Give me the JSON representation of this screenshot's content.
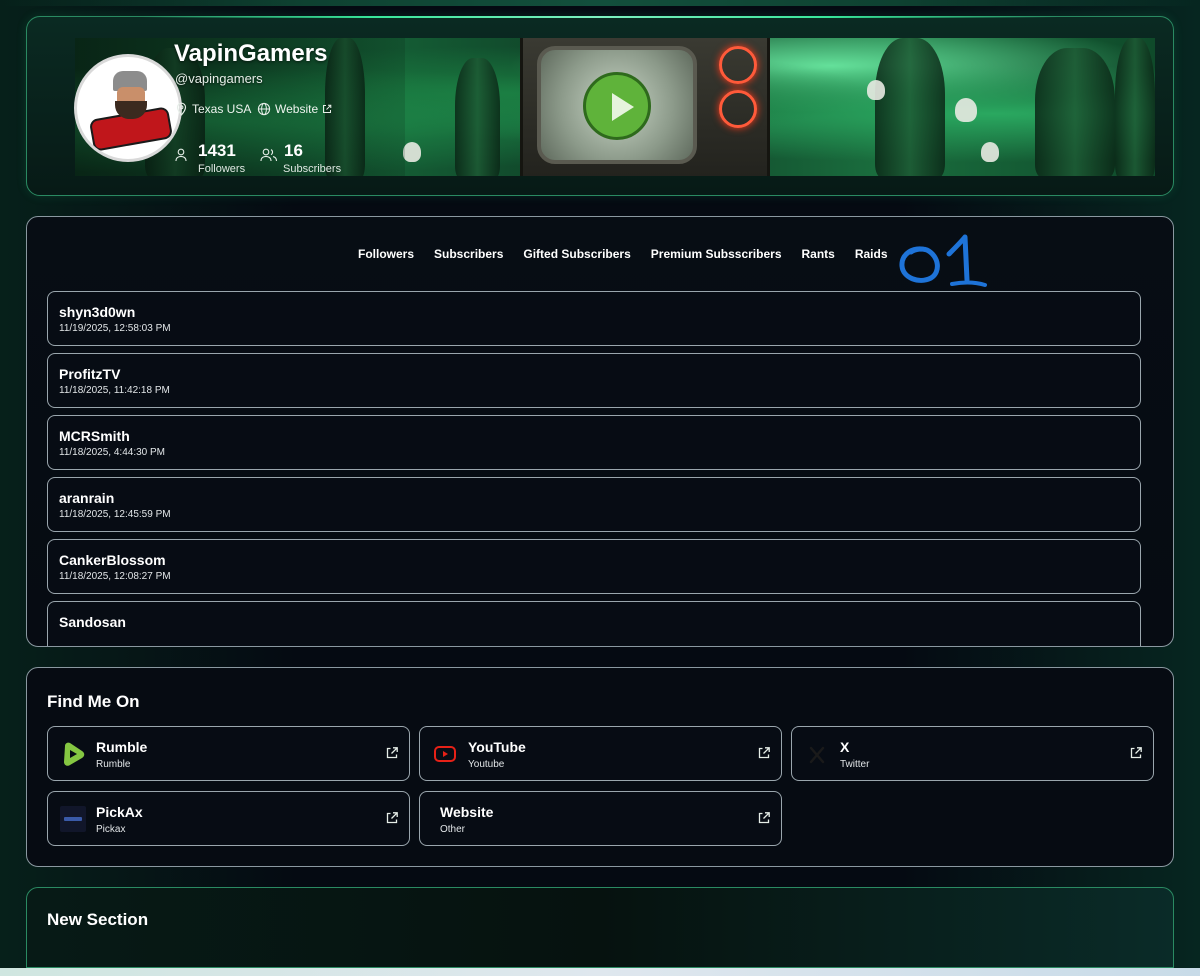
{
  "profile": {
    "name": "VapinGamers",
    "handle": "@vapingamers",
    "location": "Texas USA",
    "website_label": "Website",
    "followers_count": "1431",
    "followers_label": "Followers",
    "subscribers_count": "16",
    "subscribers_label": "Subscribers"
  },
  "tabs": [
    "Followers",
    "Subscribers",
    "Gifted Subscribers",
    "Premium Subsscribers",
    "Rants",
    "Raids"
  ],
  "annotation": "01",
  "list": [
    {
      "name": "shyn3d0wn",
      "time": "11/19/2025, 12:58:03 PM"
    },
    {
      "name": "ProfitzTV",
      "time": "11/18/2025, 11:42:18 PM"
    },
    {
      "name": "MCRSmith",
      "time": "11/18/2025, 4:44:30 PM"
    },
    {
      "name": "aranrain",
      "time": "11/18/2025, 12:45:59 PM"
    },
    {
      "name": "CankerBlossom",
      "time": "11/18/2025, 12:08:27 PM"
    },
    {
      "name": "Sandosan",
      "time": ""
    }
  ],
  "find": {
    "title": "Find Me On",
    "links": [
      {
        "name": "Rumble",
        "type": "Rumble",
        "icon": "rumble-icon"
      },
      {
        "name": "YouTube",
        "type": "Youtube",
        "icon": "youtube-icon"
      },
      {
        "name": "X",
        "type": "Twitter",
        "icon": "x-icon"
      },
      {
        "name": "PickAx",
        "type": "Pickax",
        "icon": "pickax-icon"
      },
      {
        "name": "Website",
        "type": "Other",
        "icon": ""
      }
    ]
  },
  "new_section": {
    "title": "New Section"
  },
  "colors": {
    "accent_green": "#2bd08a",
    "rumble_green": "#85c742",
    "youtube_red": "#e62117",
    "annotation_blue": "#1e73d8"
  }
}
